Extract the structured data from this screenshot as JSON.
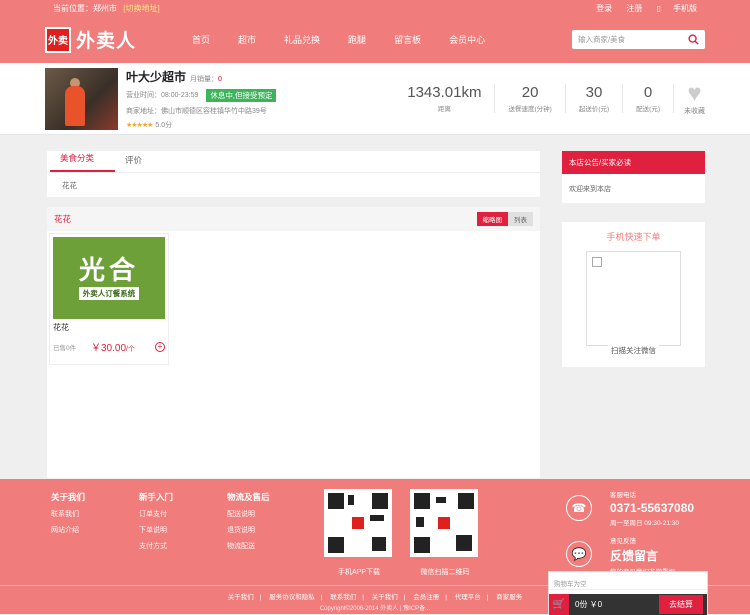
{
  "topbar": {
    "location_label": "当前位置：",
    "location": "郑州市",
    "switch": "[切换地址]",
    "login": "登录",
    "register": "注册",
    "mobile": "手机版"
  },
  "header": {
    "logo_mark": "外卖",
    "logo_text": "外卖人",
    "search_placeholder": "输入商家/美食",
    "nav": [
      "首页",
      "超市",
      "礼品兑换",
      "跑腿",
      "留言板",
      "会员中心"
    ]
  },
  "shop": {
    "name": "叶大少超市",
    "sales_label": "月销量：",
    "sales": "0",
    "hours": "营业时间：08:00-23:59",
    "status_badge": "休息中,但接受预定",
    "address": "商家地址：佛山市顺德区容桂镇华竹中路39号",
    "rating_text": "5.0分",
    "stars": "★★★★★",
    "distance": "1343.01km",
    "distance_label": "距离",
    "stats": [
      {
        "value": "20",
        "label": "送餐速度(分钟)"
      },
      {
        "value": "30",
        "label": "起送价(元)"
      },
      {
        "value": "0",
        "label": "配送(元)"
      }
    ],
    "fav_label": "未收藏"
  },
  "tabs": [
    "美食分类",
    "评价"
  ],
  "category_chip": "花花",
  "section": {
    "title": "花花",
    "view_grid": "缩略图",
    "view_list": "列表"
  },
  "product": {
    "banner_big": "光合",
    "banner_small": "外卖人订餐系统",
    "name": "花花",
    "sold": "已售0件",
    "price": "￥30.00",
    "unit": "/个",
    "add": "+"
  },
  "sidebar": {
    "notice_title": "本店公告/买家必读",
    "notice_body": "欢迎来到本店",
    "mobile_title": "手机快速下单",
    "qr_label": "扫描关注微信"
  },
  "footer": {
    "cols": [
      {
        "title": "关于我们",
        "items": [
          "联系我们",
          "网站介绍"
        ]
      },
      {
        "title": "新手入门",
        "items": [
          "订单支付",
          "下单说明",
          "支付方式"
        ]
      },
      {
        "title": "物流及售后",
        "items": [
          "配送说明",
          "退货说明",
          "物流配送"
        ]
      }
    ],
    "qr1_label": "手机APP下载",
    "qr2_label": "微信扫描二维码",
    "phone_small": "客服电话",
    "phone": "0371-55637080",
    "phone_hours": "周一至周日 09:30-21:30",
    "feedback_small": "意见反馈",
    "feedback": "反馈留言",
    "feedback_sub": "您的意见我们非常重视",
    "links": [
      "关于我们",
      "服务协议和隐私",
      "联系我们",
      "关于我们",
      "会员注册",
      "代理平台",
      "商家服务"
    ],
    "copyright": "Copyright©2006-2014 外卖人 | 豫ICP备..."
  },
  "cart": {
    "bar": "购物车为空",
    "summary": "0份 ￥0",
    "button": "去结算"
  }
}
